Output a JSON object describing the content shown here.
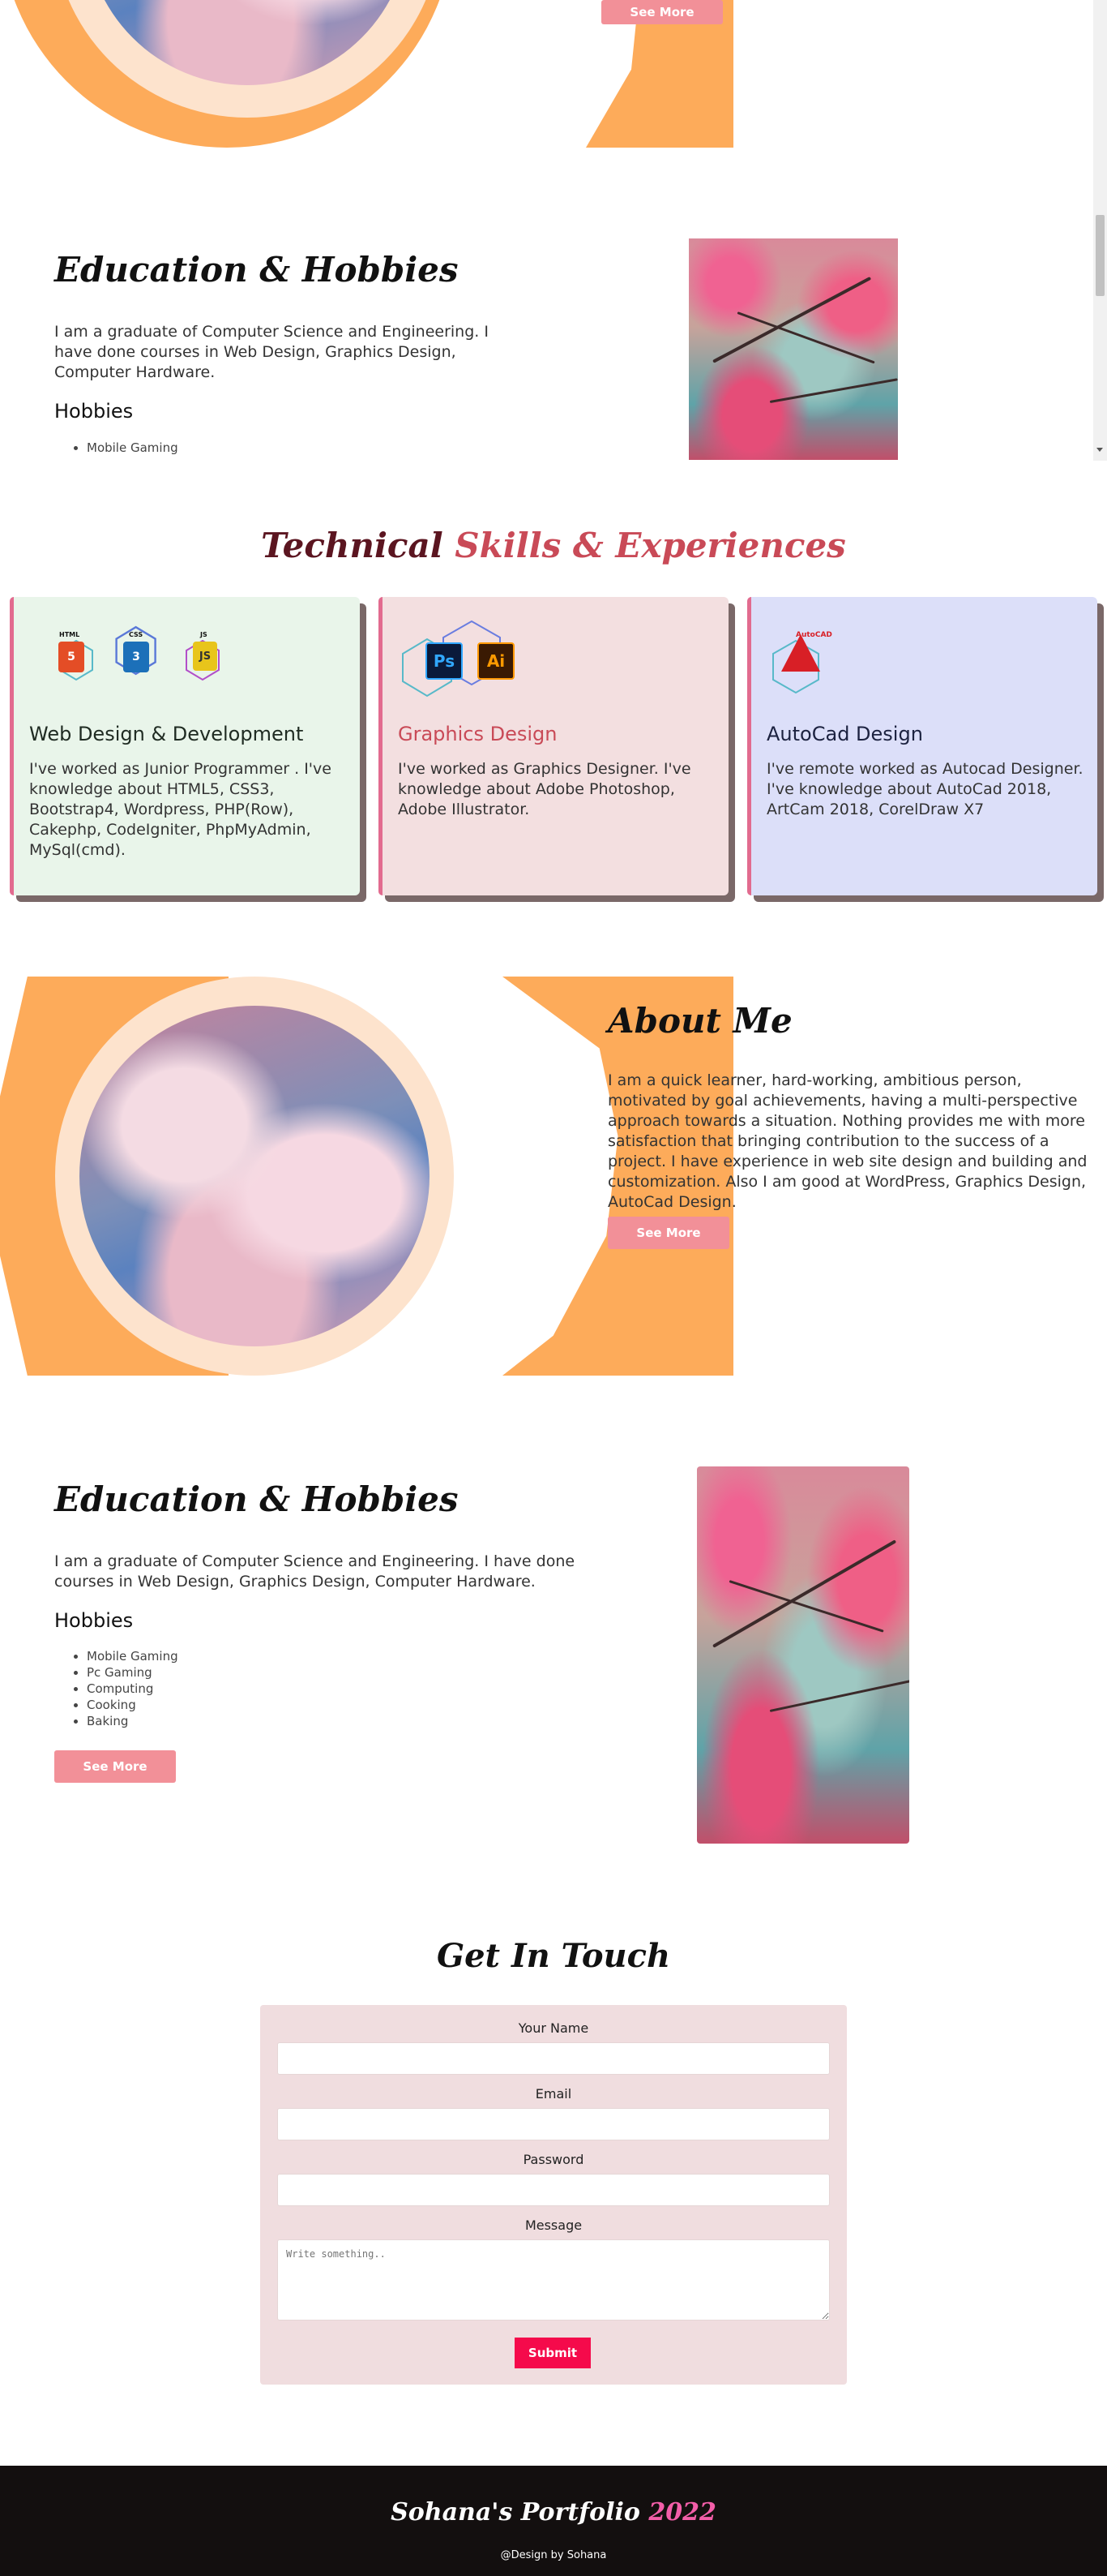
{
  "about_top": {
    "see_more": "See More"
  },
  "edu_top": {
    "title": "Education & Hobbies",
    "text": "I am a graduate of Computer Science and Engineering. I have done courses in Web Design, Graphics Design, Computer Hardware.",
    "hobbies_title": "Hobbies",
    "hobbies": [
      "Mobile Gaming"
    ]
  },
  "skills": {
    "title_part1": "Technical",
    "title_part2": "Skills & Experiences",
    "cards": [
      {
        "title": "Web Design & Development",
        "text": "I've worked as Junior Programmer . I've knowledge about HTML5, CSS3, Bootstrap4, Wordpress, PHP(Row), Cakephp, CodeIgniter, PhpMyAdmin, MySql(cmd).",
        "bg": "#e9f5ea",
        "title_color": "#1f2b22",
        "icons": [
          "HTML",
          "CSS",
          "JS"
        ]
      },
      {
        "title": "Graphics Design",
        "text": "I've worked as Graphics Designer. I've knowledge about Adobe Photoshop, Adobe Illustrator.",
        "bg": "#f3dfe0",
        "title_color": "#c94a57",
        "icons": [
          "Ps",
          "Ai"
        ]
      },
      {
        "title": "AutoCad Design",
        "text": "I've remote worked as Autocad Designer. I've knowledge about AutoCad 2018, ArtCam 2018, CorelDraw X7",
        "bg": "#dcdff9",
        "title_color": "#1c2240",
        "icons": [
          "AutoCAD"
        ]
      }
    ]
  },
  "about": {
    "title": "About Me",
    "text": "I am a quick learner, hard-working, ambitious person, motivated by goal achievements, having a multi-perspective approach towards a situation. Nothing provides me with more satisfaction that bringing contribution to the success of a project. I have experience in web site design and building and customization. Also I am good at WordPress, Graphics Design, AutoCad Design.",
    "see_more": "See More"
  },
  "edu": {
    "title": "Education & Hobbies",
    "text": "I am a graduate of Computer Science and Engineering. I have done courses in Web Design, Graphics Design, Computer Hardware.",
    "hobbies_title": "Hobbies",
    "hobbies": [
      "Mobile Gaming",
      "Pc Gaming",
      "Computing",
      "Cooking",
      "Baking"
    ],
    "see_more": "See More"
  },
  "contact": {
    "title": "Get In Touch",
    "name_label": "Your Name",
    "email_label": "Email",
    "password_label": "Password",
    "message_label": "Message",
    "message_placeholder": "Write something..",
    "submit": "Submit"
  },
  "footer": {
    "brand": "Sohana's Portfolio",
    "year": "2022",
    "credit": "@Design by Sohana"
  },
  "colors": {
    "accent": "#f29098",
    "orange": "#fdab5a",
    "submit": "#f50a4b",
    "title_red": "#c94a57"
  }
}
